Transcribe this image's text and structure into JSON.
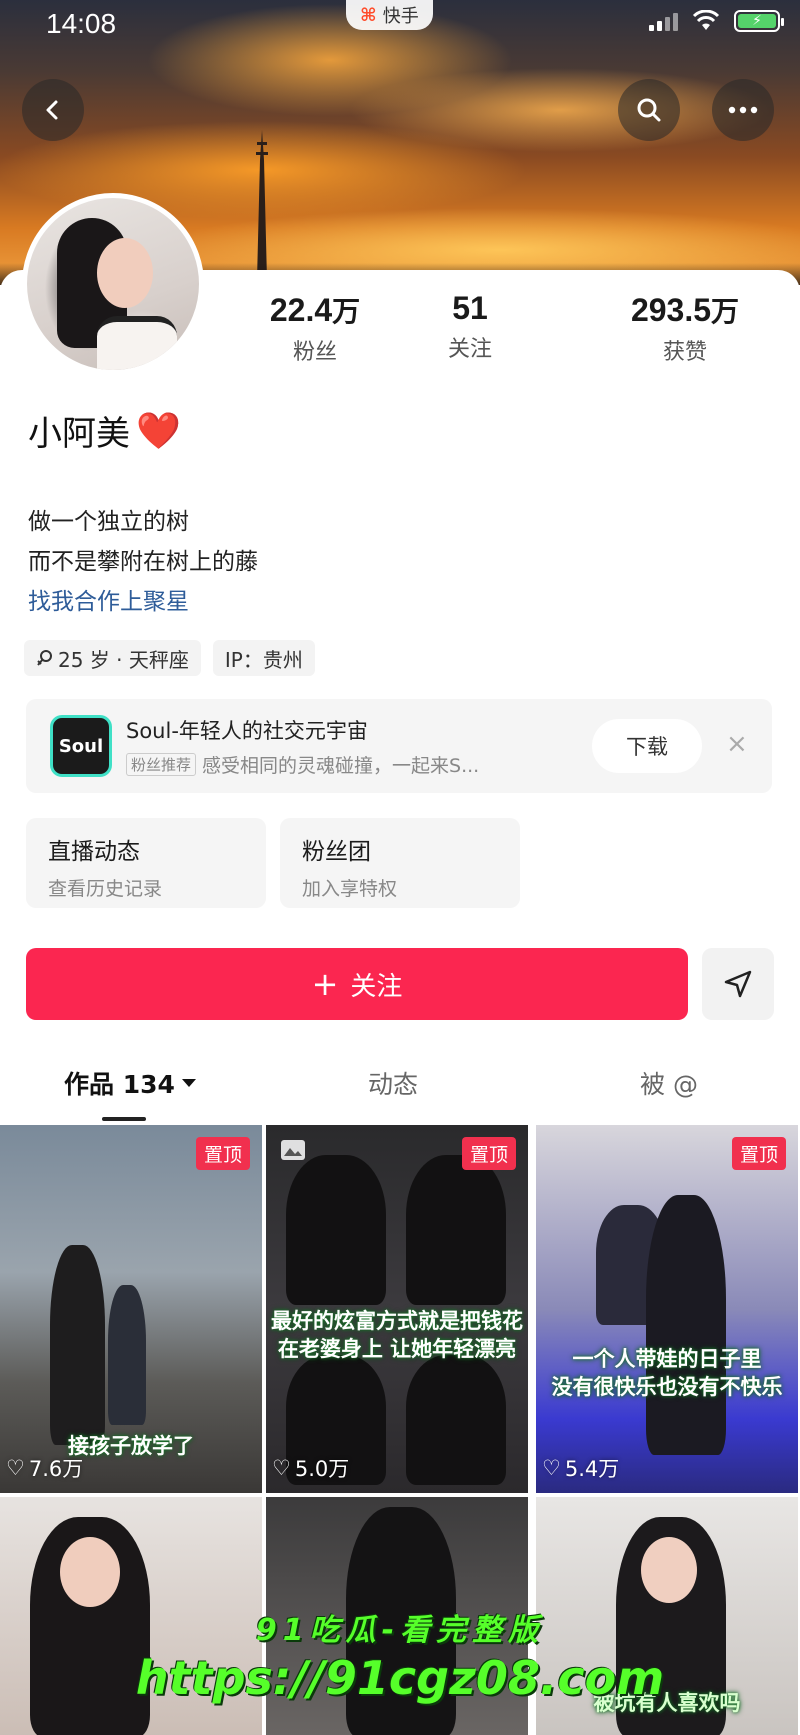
{
  "status_bar": {
    "time": "14:08",
    "app_badge": "快手"
  },
  "colors": {
    "accent": "#fb2650",
    "pin_badge": "#f1304e",
    "link": "#2e5c99",
    "watermark": "#56ff2a"
  },
  "header": {
    "icons": [
      "chevron-left-icon",
      "search-icon",
      "more-icon"
    ]
  },
  "profile": {
    "name": "小阿美",
    "name_emoji": "❤️",
    "stats": [
      {
        "value": "22.4",
        "unit": "万",
        "label": "粉丝"
      },
      {
        "value": "51",
        "unit": "",
        "label": "关注"
      },
      {
        "value": "293.5",
        "unit": "万",
        "label": "获赞"
      }
    ],
    "bio_lines": [
      "做一个独立的树",
      "而不是攀附在树上的藤"
    ],
    "bio_link": "找我合作上聚星",
    "tags": [
      "25 岁 · 天秤座",
      "IP：贵州"
    ]
  },
  "ad": {
    "logo_text": "Soul",
    "title": "Soul-年轻人的社交元宇宙",
    "badge": "粉丝推荐",
    "subtitle": "感受相同的灵魂碰撞，一起来S...",
    "button": "下载",
    "close": "×"
  },
  "quick_cards": [
    {
      "title": "直播动态",
      "subtitle": "查看历史记录"
    },
    {
      "title": "粉丝团",
      "subtitle": "加入享特权"
    }
  ],
  "actions": {
    "follow": "关注",
    "follow_prefix": "+"
  },
  "tabs": [
    {
      "label": "作品 134",
      "active": true,
      "has_dropdown": true
    },
    {
      "label": "动态",
      "active": false
    },
    {
      "label": "被 @",
      "active": false
    }
  ],
  "videos": [
    {
      "pinned": true,
      "pin_label": "置顶",
      "caption": "接孩子放学了",
      "likes": "7.6万"
    },
    {
      "pinned": true,
      "pin_label": "置顶",
      "caption_lines": [
        "最好的炫富方式就是把钱花",
        "在老婆身上 让她年轻漂亮"
      ],
      "likes": "5.0万"
    },
    {
      "pinned": true,
      "pin_label": "置顶",
      "caption_lines": [
        "一个人带娃的日子里",
        "没有很快乐也没有不快乐"
      ],
      "likes": "5.4万"
    },
    {
      "pinned": false
    },
    {
      "pinned": false
    },
    {
      "pinned": false,
      "caption": "被坑有人喜欢吗"
    }
  ],
  "watermark": {
    "line1": "91吃瓜-看完整版",
    "line2": "https://91cgz08.com"
  }
}
